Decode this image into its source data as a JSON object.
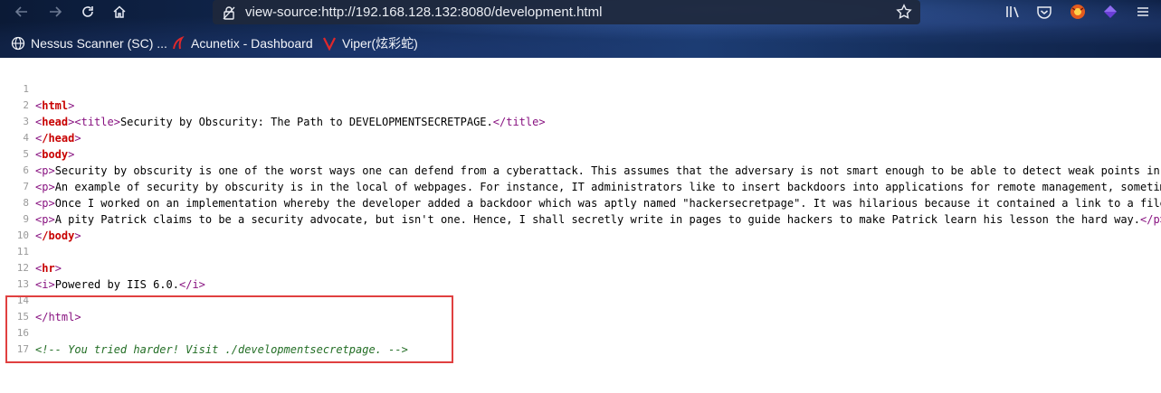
{
  "browser": {
    "url": "view-source:http://192.168.128.132:8080/development.html",
    "icons": {
      "back": "arrow-left-icon",
      "forward": "arrow-right-icon",
      "reload": "reload-icon",
      "home": "home-icon",
      "lock": "lock-icon",
      "bookmark_star": "star-icon",
      "pocket": "pocket-icon",
      "shield": "shield-icon",
      "extension_1": "fox-extension-icon",
      "extension_2": "purple-extension-icon"
    },
    "bookmarks": [
      {
        "label": "Nessus Scanner (SC) ...",
        "icon": "globe-icon"
      },
      {
        "label": "Acunetix - Dashboard",
        "icon": "acunetix-icon"
      },
      {
        "label": "Viper(炫彩蛇)",
        "icon": "viper-icon"
      }
    ]
  },
  "source": {
    "line_numbers": [
      "1",
      "2",
      "3",
      "4",
      "5",
      "6",
      "7",
      "8",
      "9",
      "10",
      "11",
      "12",
      "13",
      "14",
      "15",
      "16",
      "17"
    ],
    "l1_tag": "html",
    "l2_head": "head",
    "l2_title_open": "title",
    "l2_title_text": "Security by Obscurity: The Path to DEVELOPMENTSECRETPAGE.",
    "l2_title_close": "/title",
    "l3_tag": "/head",
    "l4_tag": "body",
    "l5_open": "p",
    "l5_text": "Security by obscurity is one of the worst ways one can defend from a cyberattack. This assumes that the adversary is not smart enough to be able to detect weak points in a corporate network.",
    "l5_close": "/p",
    "l6_open": "p",
    "l6_text": "An example of security by obscurity is in the local of webpages. For instance, IT administrators like to insert backdoors into applications for remote management, sometimes without the project teams knowin",
    "l7_open": "p",
    "l7_text": "Once I worked on an implementation whereby the developer added a backdoor which was aptly named \"hackersecretpage\". It was hilarious because it contained a link to a file upload function, where the hacker",
    "l8_open": "p",
    "l8_text": "A pity Patrick claims to be a security advocate, but isn't one. Hence, I shall secretly write in pages to guide hackers to make Patrick learn his lesson the hard way.",
    "l8_close": "/p",
    "l9_tag": "/body",
    "l11_tag": "hr",
    "l12_open": "i",
    "l12_text": "Powered by IIS 6.0.",
    "l12_close": "/i",
    "l14_tag": "/html",
    "l16_comment": "<!-- You tried harder! Visit ./developmentsecretpage. -->"
  },
  "colors": {
    "tag_purple": "#881280",
    "tag_red": "#c80000",
    "comment_green": "#236e25",
    "highlight_red": "#e04040"
  }
}
